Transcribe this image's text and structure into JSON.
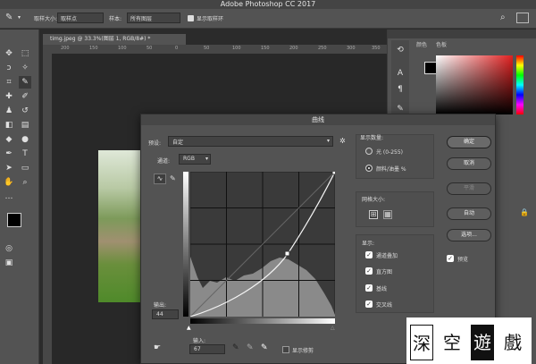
{
  "app": {
    "title": "Adobe Photoshop CC 2017"
  },
  "options_bar": {
    "sample_size_label": "取样大小:",
    "sample_size_value": "取样点",
    "sample_label": "样本:",
    "sample_value": "所有图层",
    "show_ring_label": "显示取样环"
  },
  "document": {
    "tab": "timg.jpeg @ 33.3%(图层 1, RGB/8#) *",
    "ruler_numbers": [
      "200",
      "150",
      "100",
      "50",
      "0",
      "50",
      "100",
      "150",
      "200",
      "250",
      "300",
      "350"
    ]
  },
  "right_panel": {
    "tabs": [
      "颜色",
      "色板"
    ]
  },
  "curves": {
    "title": "曲线",
    "preset_label": "预设:",
    "preset_value": "自定",
    "channel_label": "通道:",
    "channel_value": "RGB",
    "output_label": "输出:",
    "output_value": "44",
    "input_label": "输入:",
    "input_value": "67",
    "show_clipping": "显示修剪",
    "show_amount": {
      "title": "显示数量:",
      "light": "光 (0-255)",
      "pigment": "颜料/油墨 %",
      "selected": "pigment"
    },
    "grid_size": {
      "title": "网格大小:"
    },
    "display": {
      "title": "显示:",
      "items": [
        {
          "label": "通道叠加",
          "checked": true
        },
        {
          "label": "直方图",
          "checked": true
        },
        {
          "label": "基线",
          "checked": true
        },
        {
          "label": "交叉线",
          "checked": true
        }
      ]
    },
    "buttons": {
      "ok": "确定",
      "cancel": "取消",
      "smooth": "平滑",
      "auto": "自动",
      "options": "选项..."
    },
    "preview": {
      "label": "预览",
      "checked": true
    }
  },
  "watermark": {
    "chars": [
      "深",
      "空",
      "遊",
      "戲"
    ]
  },
  "colors": {
    "fg": "#000000",
    "bg": "#ffffff",
    "panel": "#535353",
    "dialog": "#535353"
  }
}
